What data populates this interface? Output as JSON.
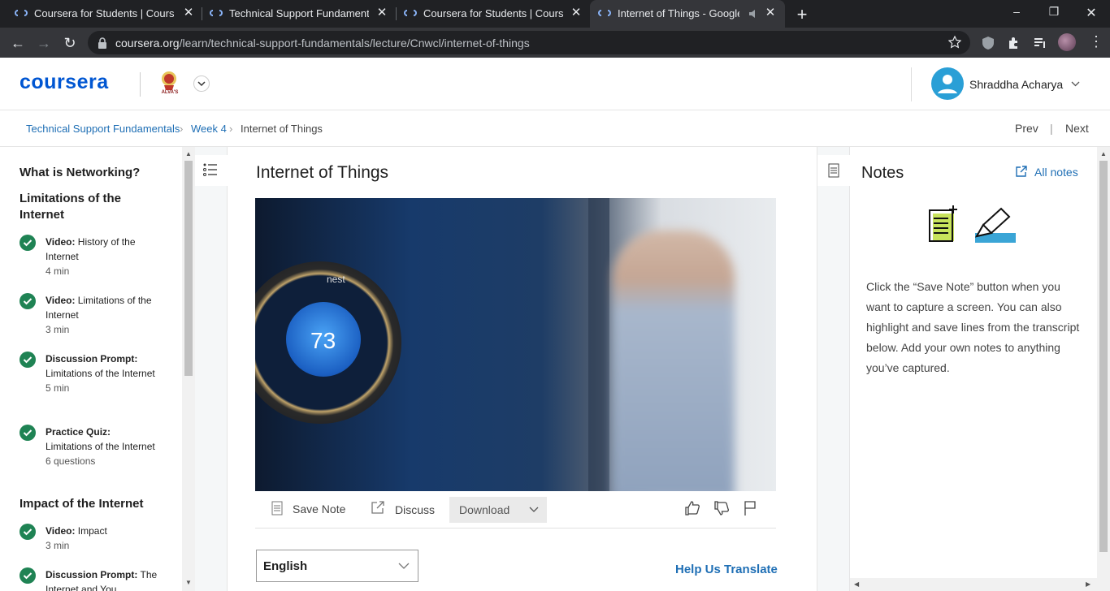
{
  "browser": {
    "tabs": [
      {
        "title": "Coursera for Students | Coursera",
        "active": false
      },
      {
        "title": "Technical Support Fundamentals",
        "active": false
      },
      {
        "title": "Coursera for Students | Coursera",
        "active": false
      },
      {
        "title": "Internet of Things - Google |",
        "active": true
      }
    ],
    "url_host": "coursera.org",
    "url_path": "/learn/technical-support-fundamentals/lecture/Cnwcl/internet-of-things"
  },
  "header": {
    "logo": "coursera",
    "partner_name": "ALVA'S",
    "user_name": "Shraddha Acharya"
  },
  "breadcrumb": {
    "items": [
      "Technical Support Fundamentals",
      "Week 4",
      "Internet of Things"
    ],
    "prev": "Prev",
    "next": "Next"
  },
  "sidebar": {
    "sections": [
      {
        "title": "What is Networking?"
      },
      {
        "title": "Limitations of the Internet"
      },
      {
        "title": "Impact of the Internet"
      }
    ],
    "items": [
      {
        "type": "Video:",
        "name": "History of the Internet",
        "meta": "4 min"
      },
      {
        "type": "Video:",
        "name": "Limitations of the Internet",
        "meta": "3 min"
      },
      {
        "type": "Discussion Prompt:",
        "name": "Limitations of the Internet",
        "meta": "5 min"
      },
      {
        "type": "Practice Quiz:",
        "name": "Limitations of the Internet",
        "meta": "6 questions"
      },
      {
        "type": "Video:",
        "name": "Impact",
        "meta": "3 min"
      },
      {
        "type": "Discussion Prompt:",
        "name": "The Internet and You",
        "meta": ""
      }
    ]
  },
  "main": {
    "title": "Internet of Things",
    "video_text": {
      "brand": "nest",
      "temperature": "73"
    },
    "actions": {
      "save_note": "Save Note",
      "discuss": "Discuss",
      "download": "Download"
    },
    "language": "English",
    "help_translate": "Help Us Translate"
  },
  "notes": {
    "title": "Notes",
    "all_notes": "All notes",
    "description": "Click the “Save Note” button when you want to capture a screen. You can also highlight and save lines from the transcript below. Add your own notes to anything you’ve captured."
  },
  "colors": {
    "coursera_blue": "#0056d2",
    "link_blue": "#1f6fb5",
    "check_green": "#1f8354",
    "avatar_blue": "#2a9fd6",
    "chrome_dark": "#202124"
  }
}
